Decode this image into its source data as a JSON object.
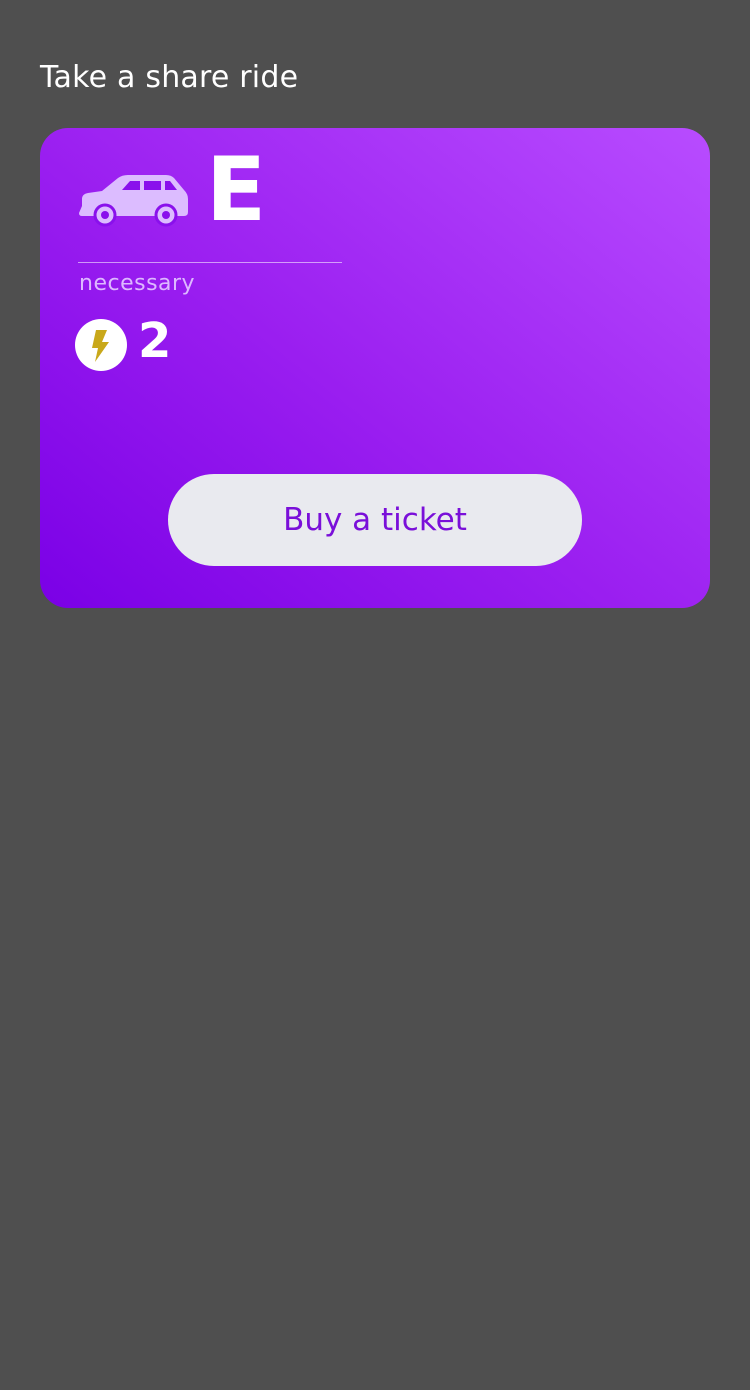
{
  "header": {
    "title": "Take a share ride"
  },
  "ride_card": {
    "vehicle_icon": "car-icon",
    "class_letter": "E",
    "class_caption": "necessary",
    "points_icon": "lightning-bolt-icon",
    "points_value": "2",
    "buy_label": "Buy a ticket",
    "colors": {
      "gradient_start": "#7a00e6",
      "gradient_end": "#b84cff",
      "button_bg": "#e9eaef",
      "button_text": "#7a0fd9",
      "bolt": "#c9a81a",
      "car": "#dcbcff"
    }
  },
  "page": {
    "background": "#4f4f4f"
  }
}
